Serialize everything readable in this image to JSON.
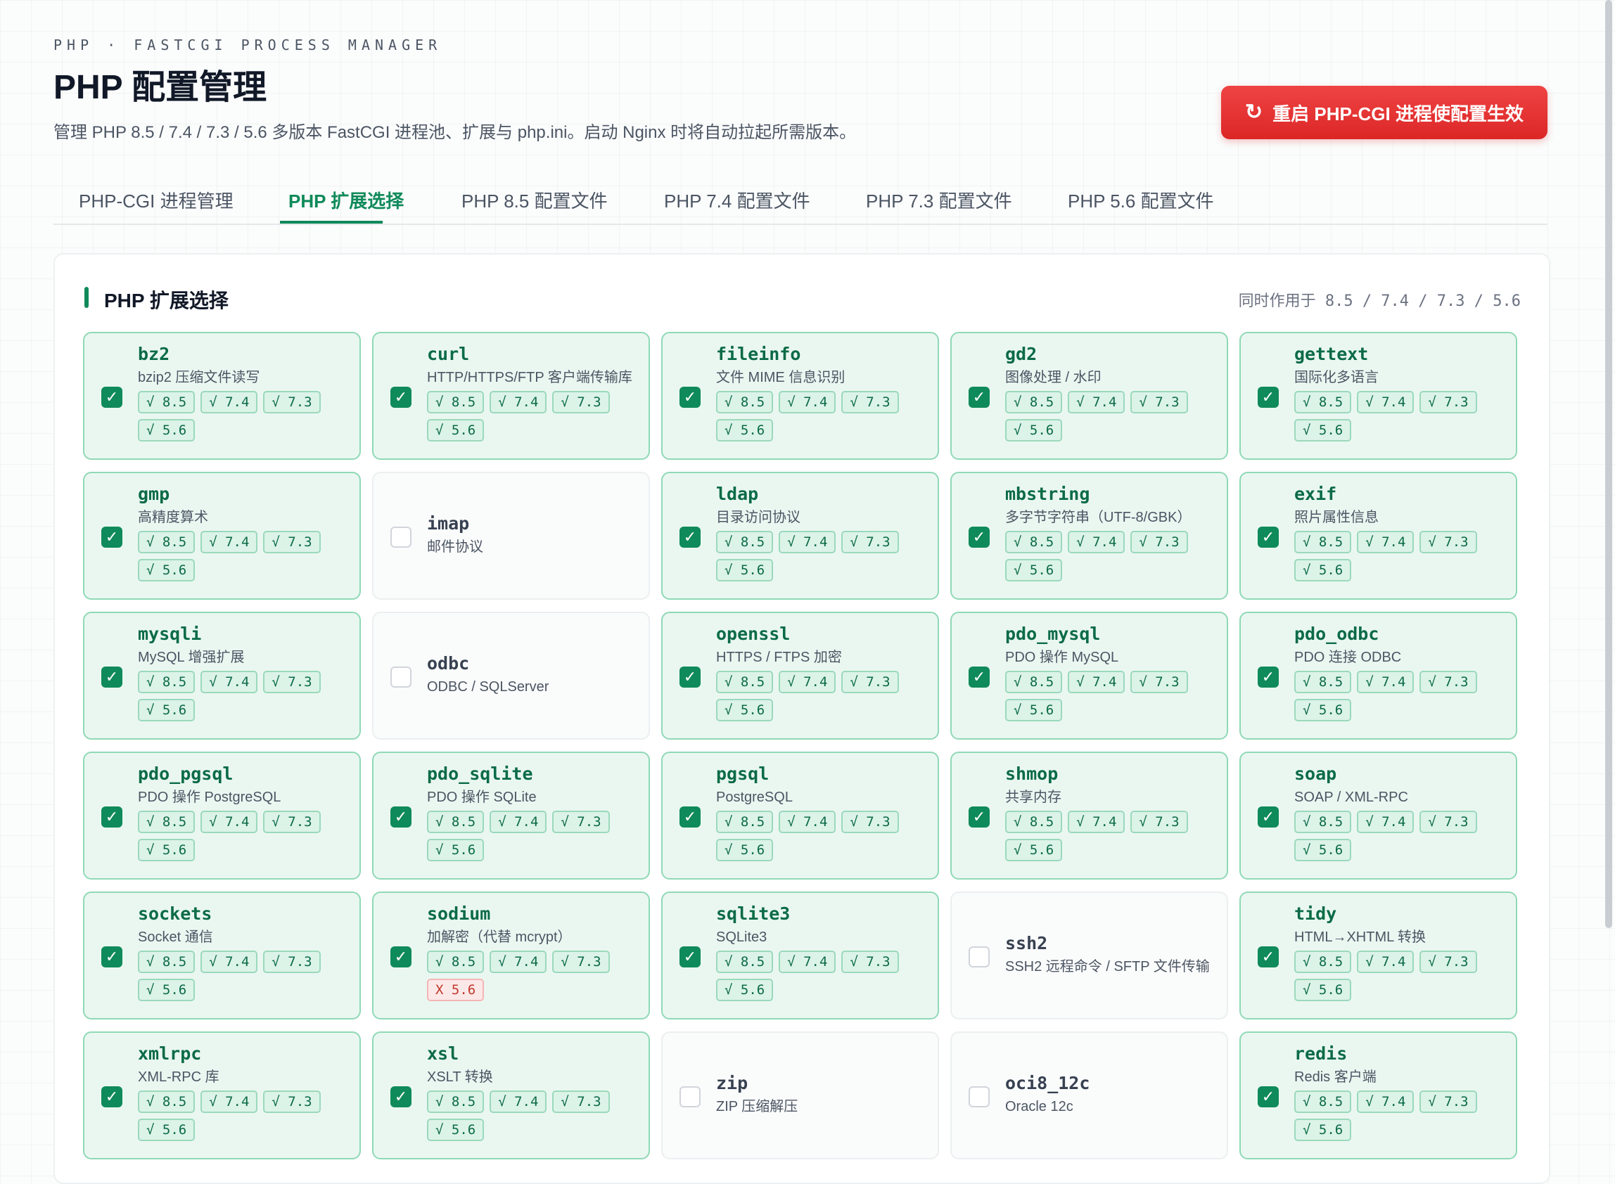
{
  "header": {
    "eyebrow": "PHP · FASTCGI PROCESS MANAGER",
    "title": "PHP 配置管理",
    "subtitle": "管理 PHP 8.5 / 7.4 / 7.3 / 5.6 多版本 FastCGI 进程池、扩展与 php.ini。启动 Nginx 时将自动拉起所需版本。",
    "restart_label": "重启 PHP-CGI 进程使配置生效",
    "restart_icon": "↻"
  },
  "tabs": [
    {
      "label": "PHP-CGI 进程管理"
    },
    {
      "label": "PHP 扩展选择"
    },
    {
      "label": "PHP 8.5 配置文件"
    },
    {
      "label": "PHP 7.4 配置文件"
    },
    {
      "label": "PHP 7.3 配置文件"
    },
    {
      "label": "PHP 5.6 配置文件"
    }
  ],
  "active_tab": "PHP 扩展选择",
  "section": {
    "title": "PHP 扩展选择",
    "note": "同时作用于 8.5 / 7.4 / 7.3 / 5.6"
  },
  "colors": {
    "accent": "#0f8a5a",
    "danger": "#dc2626",
    "enabled_bg": "#eaf7f1"
  },
  "extensions": [
    {
      "name": "bz2",
      "desc": "bzip2 压缩文件读写",
      "enabled": true,
      "badges": [
        "√ 8.5",
        "√ 7.4",
        "√ 7.3",
        "√ 5.6"
      ]
    },
    {
      "name": "curl",
      "desc": "HTTP/HTTPS/FTP 客户端传输库",
      "enabled": true,
      "badges": [
        "√ 8.5",
        "√ 7.4",
        "√ 7.3",
        "√ 5.6"
      ]
    },
    {
      "name": "fileinfo",
      "desc": "文件 MIME 信息识别",
      "enabled": true,
      "badges": [
        "√ 8.5",
        "√ 7.4",
        "√ 7.3",
        "√ 5.6"
      ]
    },
    {
      "name": "gd2",
      "desc": "图像处理 / 水印",
      "enabled": true,
      "badges": [
        "√ 8.5",
        "√ 7.4",
        "√ 7.3",
        "√ 5.6"
      ]
    },
    {
      "name": "gettext",
      "desc": "国际化多语言",
      "enabled": true,
      "badges": [
        "√ 8.5",
        "√ 7.4",
        "√ 7.3",
        "√ 5.6"
      ]
    },
    {
      "name": "gmp",
      "desc": "高精度算术",
      "enabled": true,
      "badges": [
        "√ 8.5",
        "√ 7.4",
        "√ 7.3",
        "√ 5.6"
      ]
    },
    {
      "name": "imap",
      "desc": "邮件协议",
      "enabled": false,
      "badges": []
    },
    {
      "name": "ldap",
      "desc": "目录访问协议",
      "enabled": true,
      "badges": [
        "√ 8.5",
        "√ 7.4",
        "√ 7.3",
        "√ 5.6"
      ]
    },
    {
      "name": "mbstring",
      "desc": "多字节字符串（UTF-8/GBK）",
      "enabled": true,
      "badges": [
        "√ 8.5",
        "√ 7.4",
        "√ 7.3",
        "√ 5.6"
      ]
    },
    {
      "name": "exif",
      "desc": "照片属性信息",
      "enabled": true,
      "badges": [
        "√ 8.5",
        "√ 7.4",
        "√ 7.3",
        "√ 5.6"
      ]
    },
    {
      "name": "mysqli",
      "desc": "MySQL 增强扩展",
      "enabled": true,
      "badges": [
        "√ 8.5",
        "√ 7.4",
        "√ 7.3",
        "√ 5.6"
      ]
    },
    {
      "name": "odbc",
      "desc": "ODBC / SQLServer",
      "enabled": false,
      "badges": []
    },
    {
      "name": "openssl",
      "desc": "HTTPS / FTPS 加密",
      "enabled": true,
      "badges": [
        "√ 8.5",
        "√ 7.4",
        "√ 7.3",
        "√ 5.6"
      ]
    },
    {
      "name": "pdo_mysql",
      "desc": "PDO 操作 MySQL",
      "enabled": true,
      "badges": [
        "√ 8.5",
        "√ 7.4",
        "√ 7.3",
        "√ 5.6"
      ]
    },
    {
      "name": "pdo_odbc",
      "desc": "PDO 连接 ODBC",
      "enabled": true,
      "badges": [
        "√ 8.5",
        "√ 7.4",
        "√ 7.3",
        "√ 5.6"
      ]
    },
    {
      "name": "pdo_pgsql",
      "desc": "PDO 操作 PostgreSQL",
      "enabled": true,
      "badges": [
        "√ 8.5",
        "√ 7.4",
        "√ 7.3",
        "√ 5.6"
      ]
    },
    {
      "name": "pdo_sqlite",
      "desc": "PDO 操作 SQLite",
      "enabled": true,
      "badges": [
        "√ 8.5",
        "√ 7.4",
        "√ 7.3",
        "√ 5.6"
      ]
    },
    {
      "name": "pgsql",
      "desc": "PostgreSQL",
      "enabled": true,
      "badges": [
        "√ 8.5",
        "√ 7.4",
        "√ 7.3",
        "√ 5.6"
      ]
    },
    {
      "name": "shmop",
      "desc": "共享内存",
      "enabled": true,
      "badges": [
        "√ 8.5",
        "√ 7.4",
        "√ 7.3",
        "√ 5.6"
      ]
    },
    {
      "name": "soap",
      "desc": "SOAP / XML-RPC",
      "enabled": true,
      "badges": [
        "√ 8.5",
        "√ 7.4",
        "√ 7.3",
        "√ 5.6"
      ]
    },
    {
      "name": "sockets",
      "desc": "Socket 通信",
      "enabled": true,
      "badges": [
        "√ 8.5",
        "√ 7.4",
        "√ 7.3",
        "√ 5.6"
      ]
    },
    {
      "name": "sodium",
      "desc": "加解密（代替 mcrypt）",
      "enabled": true,
      "badges": [
        "√ 8.5",
        "√ 7.4",
        "√ 7.3",
        "X 5.6"
      ]
    },
    {
      "name": "sqlite3",
      "desc": "SQLite3",
      "enabled": true,
      "badges": [
        "√ 8.5",
        "√ 7.4",
        "√ 7.3",
        "√ 5.6"
      ]
    },
    {
      "name": "ssh2",
      "desc": "SSH2 远程命令 / SFTP 文件传输",
      "enabled": false,
      "badges": []
    },
    {
      "name": "tidy",
      "desc": "HTML→XHTML 转换",
      "enabled": true,
      "badges": [
        "√ 8.5",
        "√ 7.4",
        "√ 7.3",
        "√ 5.6"
      ]
    },
    {
      "name": "xmlrpc",
      "desc": "XML-RPC 库",
      "enabled": true,
      "badges": [
        "√ 8.5",
        "√ 7.4",
        "√ 7.3",
        "√ 5.6"
      ]
    },
    {
      "name": "xsl",
      "desc": "XSLT 转换",
      "enabled": true,
      "badges": [
        "√ 8.5",
        "√ 7.4",
        "√ 7.3",
        "√ 5.6"
      ]
    },
    {
      "name": "zip",
      "desc": "ZIP 压缩解压",
      "enabled": false,
      "badges": []
    },
    {
      "name": "oci8_12c",
      "desc": "Oracle 12c",
      "enabled": false,
      "badges": []
    },
    {
      "name": "redis",
      "desc": "Redis 客户端",
      "enabled": true,
      "badges": [
        "√ 8.5",
        "√ 7.4",
        "√ 7.3",
        "√ 5.6"
      ]
    }
  ]
}
